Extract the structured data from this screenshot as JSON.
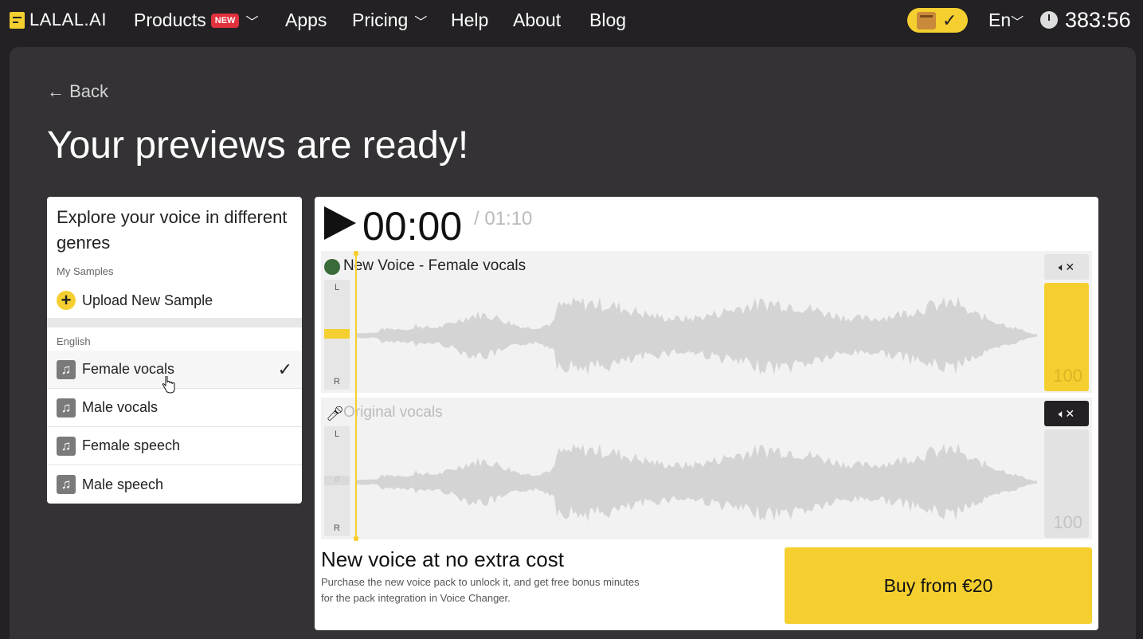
{
  "nav": {
    "logo": "LALAL.AI",
    "products": "Products",
    "products_badge": "NEW",
    "apps": "Apps",
    "pricing": "Pricing",
    "help": "Help",
    "about": "About",
    "blog": "Blog",
    "lang": "En",
    "timer": "383:56"
  },
  "page": {
    "back": "← Back",
    "title": "Your previews are ready!"
  },
  "left": {
    "title": "Explore your voice in different genres",
    "my_samples_label": "My Samples",
    "upload_label": "Upload New Sample",
    "english_label": "English",
    "genres": [
      {
        "label": "Female vocals",
        "selected": true
      },
      {
        "label": "Male vocals",
        "selected": false
      },
      {
        "label": "Female speech",
        "selected": false
      },
      {
        "label": "Male speech",
        "selected": false
      }
    ]
  },
  "player": {
    "current_time": "00:00",
    "total_time": "/ 01:10",
    "tracks": [
      {
        "name": "New Voice - Female vocals",
        "l": "L",
        "r": "R",
        "mid": "0",
        "volume": "100",
        "muted": false
      },
      {
        "name": "Original vocals",
        "l": "L",
        "r": "R",
        "mid": "0",
        "volume": "100",
        "muted": true
      }
    ],
    "playhead_fraction": 0.0
  },
  "offer": {
    "title": "New voice at no extra cost",
    "description": "Purchase the new voice pack to unlock it, and get free bonus minutes for the pack integration in Voice Changer.",
    "buy_label": "Buy from €20"
  },
  "colors": {
    "accent": "#f5cf2f",
    "background": "#232124",
    "panel": "#343235",
    "waveform": "#d4d4d4"
  }
}
